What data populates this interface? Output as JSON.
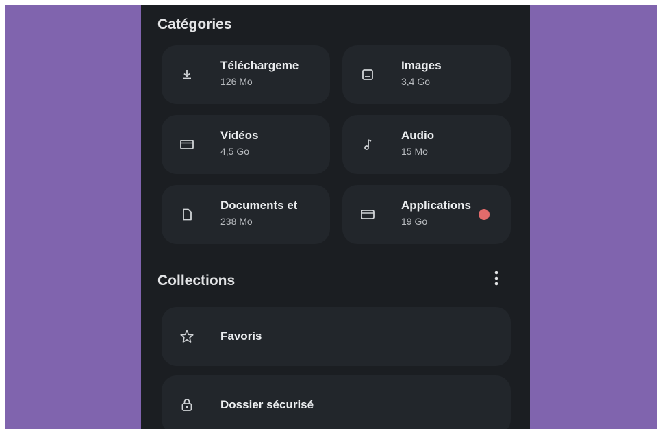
{
  "categories": {
    "title": "Catégories",
    "items": [
      {
        "label": "Téléchargeme",
        "size": "126 Mo",
        "icon": "download-icon"
      },
      {
        "label": "Images",
        "size": "3,4 Go",
        "icon": "image-icon"
      },
      {
        "label": "Vidéos",
        "size": "4,5 Go",
        "icon": "video-icon"
      },
      {
        "label": "Audio",
        "size": "15 Mo",
        "icon": "music-note-icon"
      },
      {
        "label": "Documents et",
        "size": "238 Mo",
        "icon": "document-icon"
      },
      {
        "label": "Applications",
        "size": "19 Go",
        "icon": "apps-icon"
      }
    ]
  },
  "collections": {
    "title": "Collections",
    "more_icon": "more-vert-icon",
    "items": [
      {
        "label": "Favoris",
        "icon": "star-outline-icon"
      },
      {
        "label": "Dossier sécurisé",
        "icon": "lock-icon"
      }
    ]
  },
  "colors": {
    "background": "#8064ae",
    "surface": "#1b1e22",
    "card": "#22262b",
    "text": "#eceef0",
    "touch_indicator": "#e26b6b"
  }
}
